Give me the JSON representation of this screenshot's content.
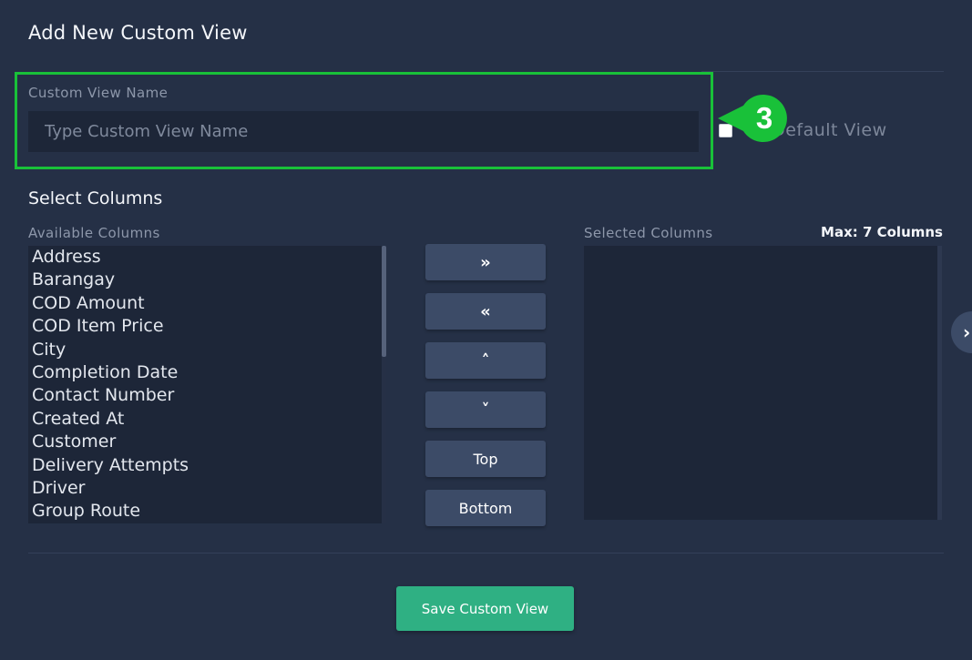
{
  "dialog": {
    "title": "Add New Custom View"
  },
  "name_field": {
    "label": "Custom View Name",
    "placeholder": "Type Custom View Name",
    "value": ""
  },
  "default_view": {
    "label_visible": "as Default View",
    "checked": false
  },
  "callout": {
    "number": "3",
    "color": "#19c139"
  },
  "columns": {
    "section_title": "Select Columns",
    "available_label": "Available Columns",
    "selected_label": "Selected Columns",
    "max_label": "Max: 7 Columns",
    "available": [
      "Address",
      "Barangay",
      "COD Amount",
      "COD Item Price",
      "City",
      "Completion Date",
      "Contact Number",
      "Created At",
      "Customer",
      "Delivery Attempts",
      "Driver",
      "Group Route"
    ],
    "selected": []
  },
  "move_buttons": {
    "add_icon": "double-chevron-right-icon",
    "add_glyph": "»",
    "remove_icon": "double-chevron-left-icon",
    "remove_glyph": "«",
    "up_icon": "chevron-up-icon",
    "up_glyph": "˄",
    "down_icon": "chevron-down-icon",
    "down_glyph": "˅",
    "top_label": "Top",
    "bottom_label": "Bottom"
  },
  "side_tab": {
    "icon": "chevron-right-icon",
    "glyph": "›"
  },
  "save_button": {
    "label": "Save Custom View"
  },
  "colors": {
    "background": "#253046",
    "input_bg": "#1d2638",
    "button_bg": "#3c4b67",
    "accent": "#2fb083",
    "highlight": "#19c139"
  }
}
